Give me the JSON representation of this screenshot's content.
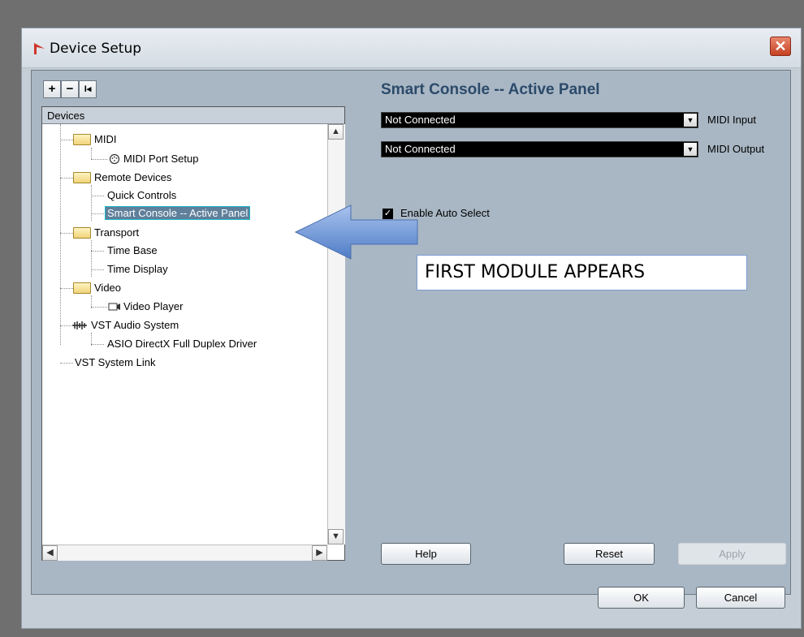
{
  "window": {
    "title": "Device Setup",
    "close_glyph": "✕"
  },
  "toolbar": {
    "add": "+",
    "remove": "−",
    "reset": "I◂"
  },
  "tree": {
    "header": "Devices",
    "nodes": [
      {
        "label": "MIDI",
        "icon": "folder-icon"
      },
      {
        "label": "MIDI Port Setup",
        "icon": "midi-port-icon"
      },
      {
        "label": "Remote Devices",
        "icon": "folder-icon"
      },
      {
        "label": "Quick Controls"
      },
      {
        "label": "Smart Console -- Active Panel",
        "selected": true
      },
      {
        "label": "Transport",
        "icon": "folder-icon"
      },
      {
        "label": "Time Base"
      },
      {
        "label": "Time Display"
      },
      {
        "label": "Video",
        "icon": "folder-icon"
      },
      {
        "label": "Video Player",
        "icon": "video-player-icon"
      },
      {
        "label": "VST Audio System",
        "icon": "audio-system-icon"
      },
      {
        "label": "ASIO DirectX Full Duplex Driver"
      },
      {
        "label": "VST System Link"
      }
    ]
  },
  "panel": {
    "title": "Smart Console -- Active Panel",
    "midi_input": {
      "value": "Not Connected",
      "label": "MIDI Input"
    },
    "midi_output": {
      "value": "Not Connected",
      "label": "MIDI Output"
    },
    "auto_select": {
      "label": "Enable Auto Select",
      "checked": true
    }
  },
  "buttons": {
    "help": "Help",
    "reset": "Reset",
    "apply": "Apply",
    "ok": "OK",
    "cancel": "Cancel"
  },
  "annotation": {
    "text": "FIRST MODULE APPEARS"
  },
  "colors": {
    "panel_title": "#2c4a6a",
    "selection": "#5f7f9a",
    "callout_arrow": "#6a93d6"
  }
}
